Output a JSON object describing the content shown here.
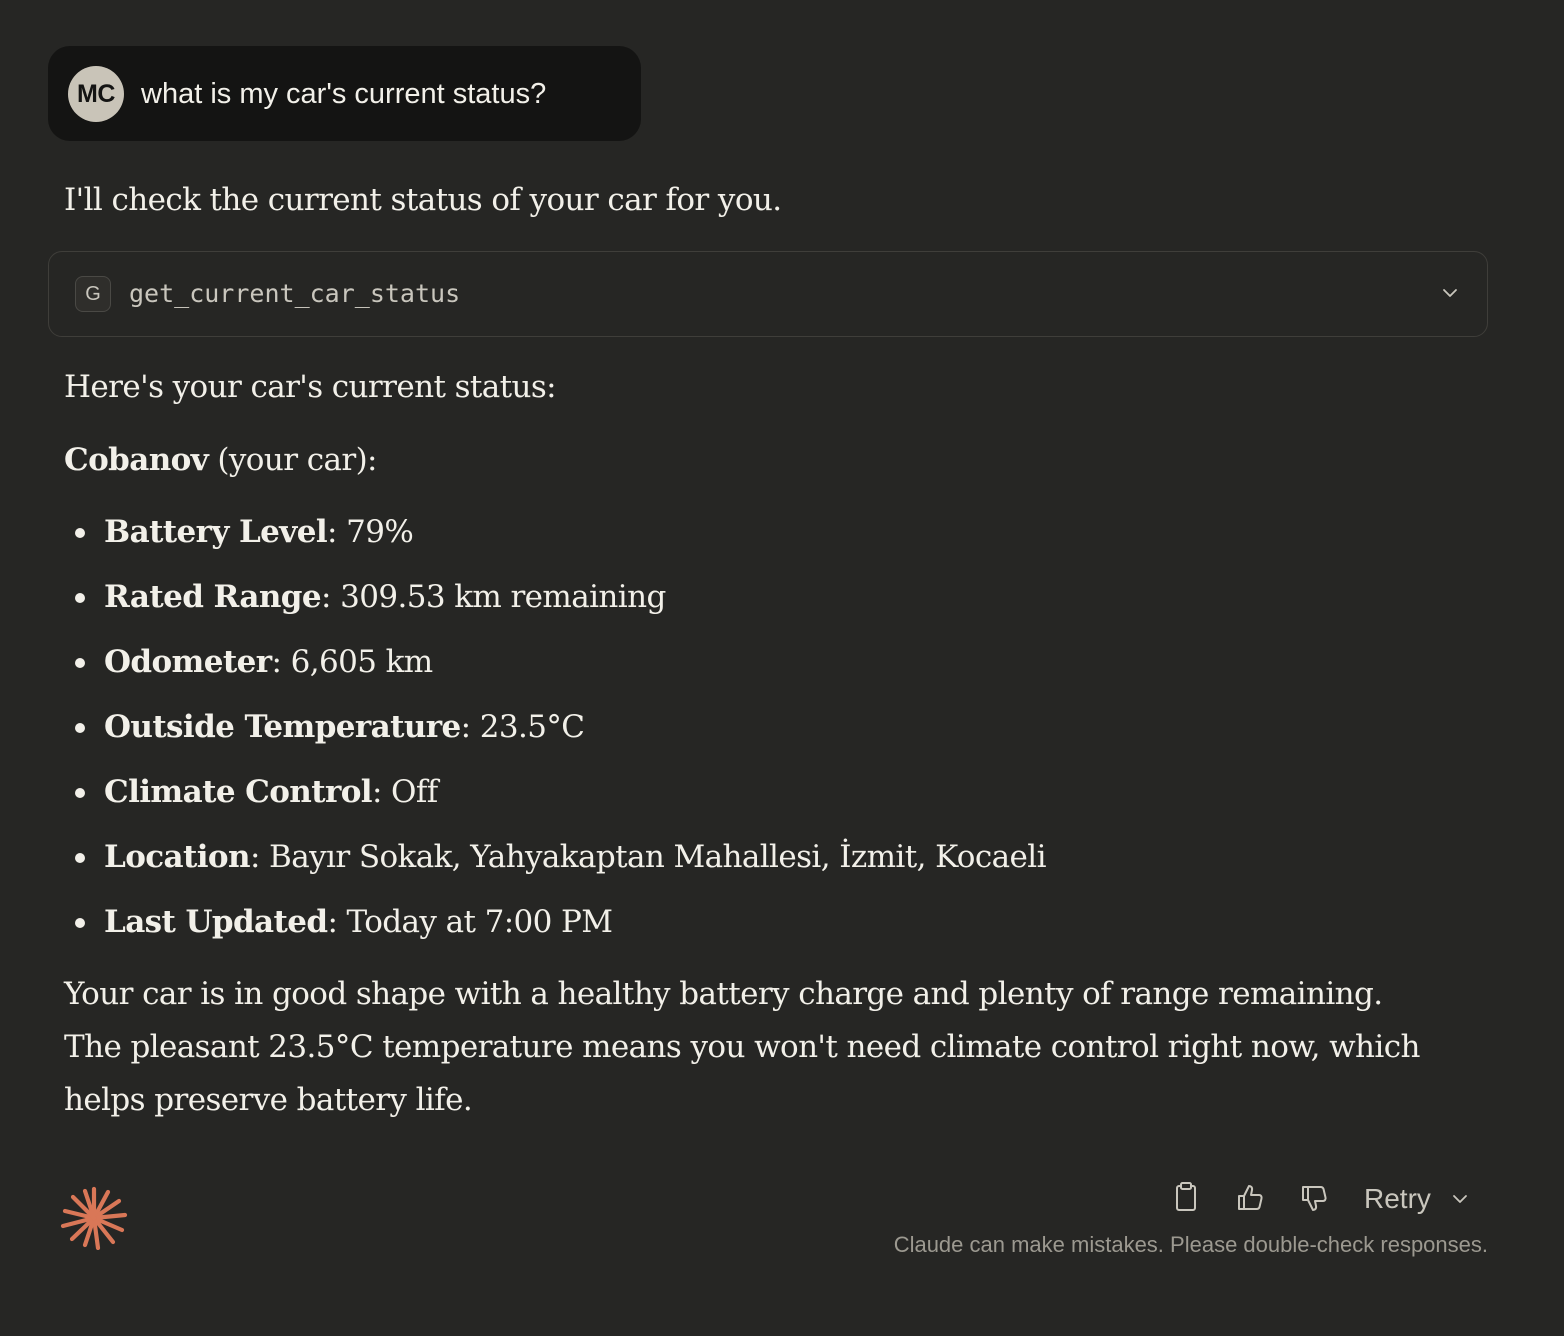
{
  "user_message": {
    "avatar_initials": "MC",
    "text": "what is my car's current status?"
  },
  "assistant": {
    "intro": "I'll check the current status of your car for you.",
    "tool_call": {
      "badge": "G",
      "name": "get_current_car_status",
      "chevron_icon": "chevron-down-icon"
    },
    "heading": "Here's your car's current status:",
    "car_name": "Cobanov",
    "car_suffix": " (your car):",
    "status_items": [
      {
        "label": "Battery Level",
        "value": ": 79%"
      },
      {
        "label": "Rated Range",
        "value": ": 309.53 km remaining"
      },
      {
        "label": "Odometer",
        "value": ": 6,605 km"
      },
      {
        "label": "Outside Temperature",
        "value": ": 23.5°C"
      },
      {
        "label": "Climate Control",
        "value": ": Off"
      },
      {
        "label": "Location",
        "value": ": Bayır Sokak, Yahyakaptan Mahallesi, İzmit, Kocaeli"
      },
      {
        "label": "Last Updated",
        "value": ": Today at 7:00 PM"
      }
    ],
    "summary": "Your car is in good shape with a healthy battery charge and plenty of range remaining. The pleasant 23.5°C temperature means you won't need climate control right now, which helps preserve battery life."
  },
  "footer": {
    "logo_icon": "claude-sparkle-icon",
    "copy_icon": "clipboard-icon",
    "thumbs_up_icon": "thumbs-up-icon",
    "thumbs_down_icon": "thumbs-down-icon",
    "retry_label": "Retry",
    "disclaimer": "Claude can make mistakes. Please double-check responses."
  },
  "colors": {
    "background": "#262624",
    "user_bubble": "#141413",
    "text": "#f2f0e9",
    "muted_text": "#9c9990",
    "accent": "#d97757"
  }
}
